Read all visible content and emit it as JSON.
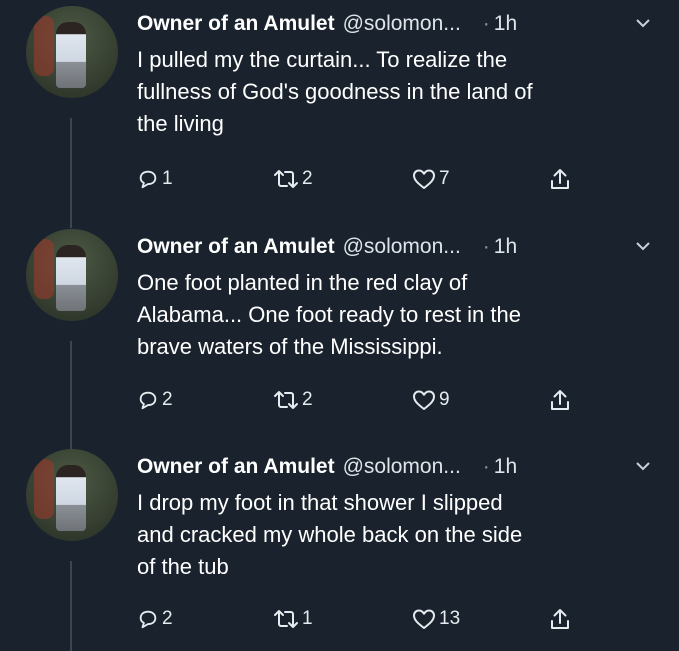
{
  "tweets": [
    {
      "name": "Owner of an Amulet",
      "handle": "@solomon...",
      "dot": "·",
      "time": "1h",
      "lines": [
        "I pulled my the curtain... To realize the",
        "fullness of God's goodness in the land of",
        "the living"
      ],
      "replies": "1",
      "retweets": "2",
      "likes": "7"
    },
    {
      "name": "Owner of an Amulet",
      "handle": "@solomon...",
      "dot": "·",
      "time": "1h",
      "lines": [
        "One foot planted in the red clay of",
        "Alabama... One foot ready to rest in the",
        "brave waters of the Mississippi."
      ],
      "replies": "2",
      "retweets": "2",
      "likes": "9"
    },
    {
      "name": "Owner of an Amulet",
      "handle": "@solomon...",
      "dot": "·",
      "time": "1h",
      "lines": [
        "I drop my foot in that shower I slipped",
        "and cracked my whole back on the side",
        "of the tub"
      ],
      "replies": "2",
      "retweets": "1",
      "likes": "13"
    }
  ],
  "icons": {
    "reply": "reply-icon",
    "retweet": "retweet-icon",
    "like": "heart-icon",
    "share": "share-icon",
    "menu": "chevron-down-icon"
  },
  "colors": {
    "background": "#1a232d",
    "text": "#ffffff",
    "secondary": "#8899a6"
  }
}
